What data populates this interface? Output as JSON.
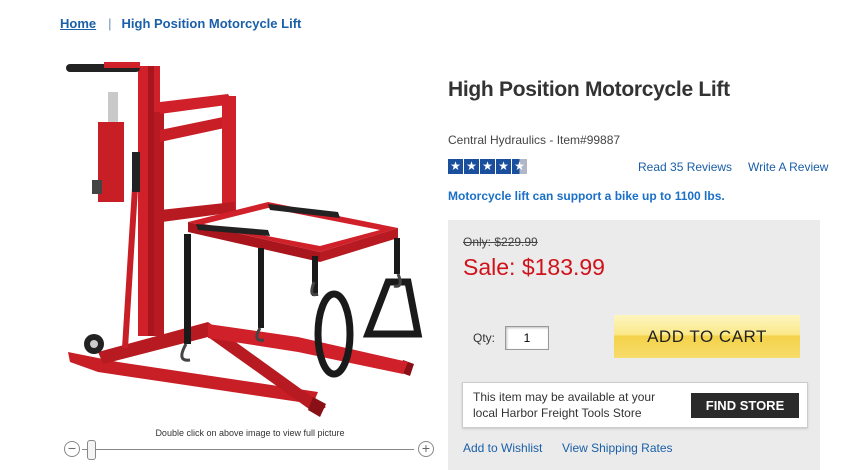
{
  "breadcrumb": {
    "home": "Home",
    "separator": "|",
    "current": "High Position Motorcycle Lift"
  },
  "image": {
    "caption": "Double click on above image to view full picture",
    "alt_icon": "motorcycle-lift-image"
  },
  "zoom": {
    "minus": "−",
    "plus": "+",
    "level": 0.05
  },
  "product": {
    "title": "High Position Motorcycle Lift",
    "brand_line": "Central Hydraulics - Item#99887",
    "rating": 4.5,
    "reviews_link": "Read 35 Reviews",
    "write_review": "Write A Review",
    "tagline": "Motorcycle lift can support a bike up to 1100 lbs."
  },
  "pricing": {
    "original": "Only: $229.99",
    "sale": "Sale: $183.99",
    "qty_label": "Qty:",
    "qty_value": "1",
    "add_to_cart": "ADD TO CART"
  },
  "store": {
    "text": "This item may be available at your local Harbor Freight Tools Store",
    "button": "FIND STORE"
  },
  "links": {
    "wishlist": "Add to Wishlist",
    "shipping": "View Shipping Rates"
  },
  "colors": {
    "link": "#1a5fa8",
    "sale": "#d0121b",
    "lift_red": "#d0202a",
    "cart_yellow": "#f7df6a"
  }
}
